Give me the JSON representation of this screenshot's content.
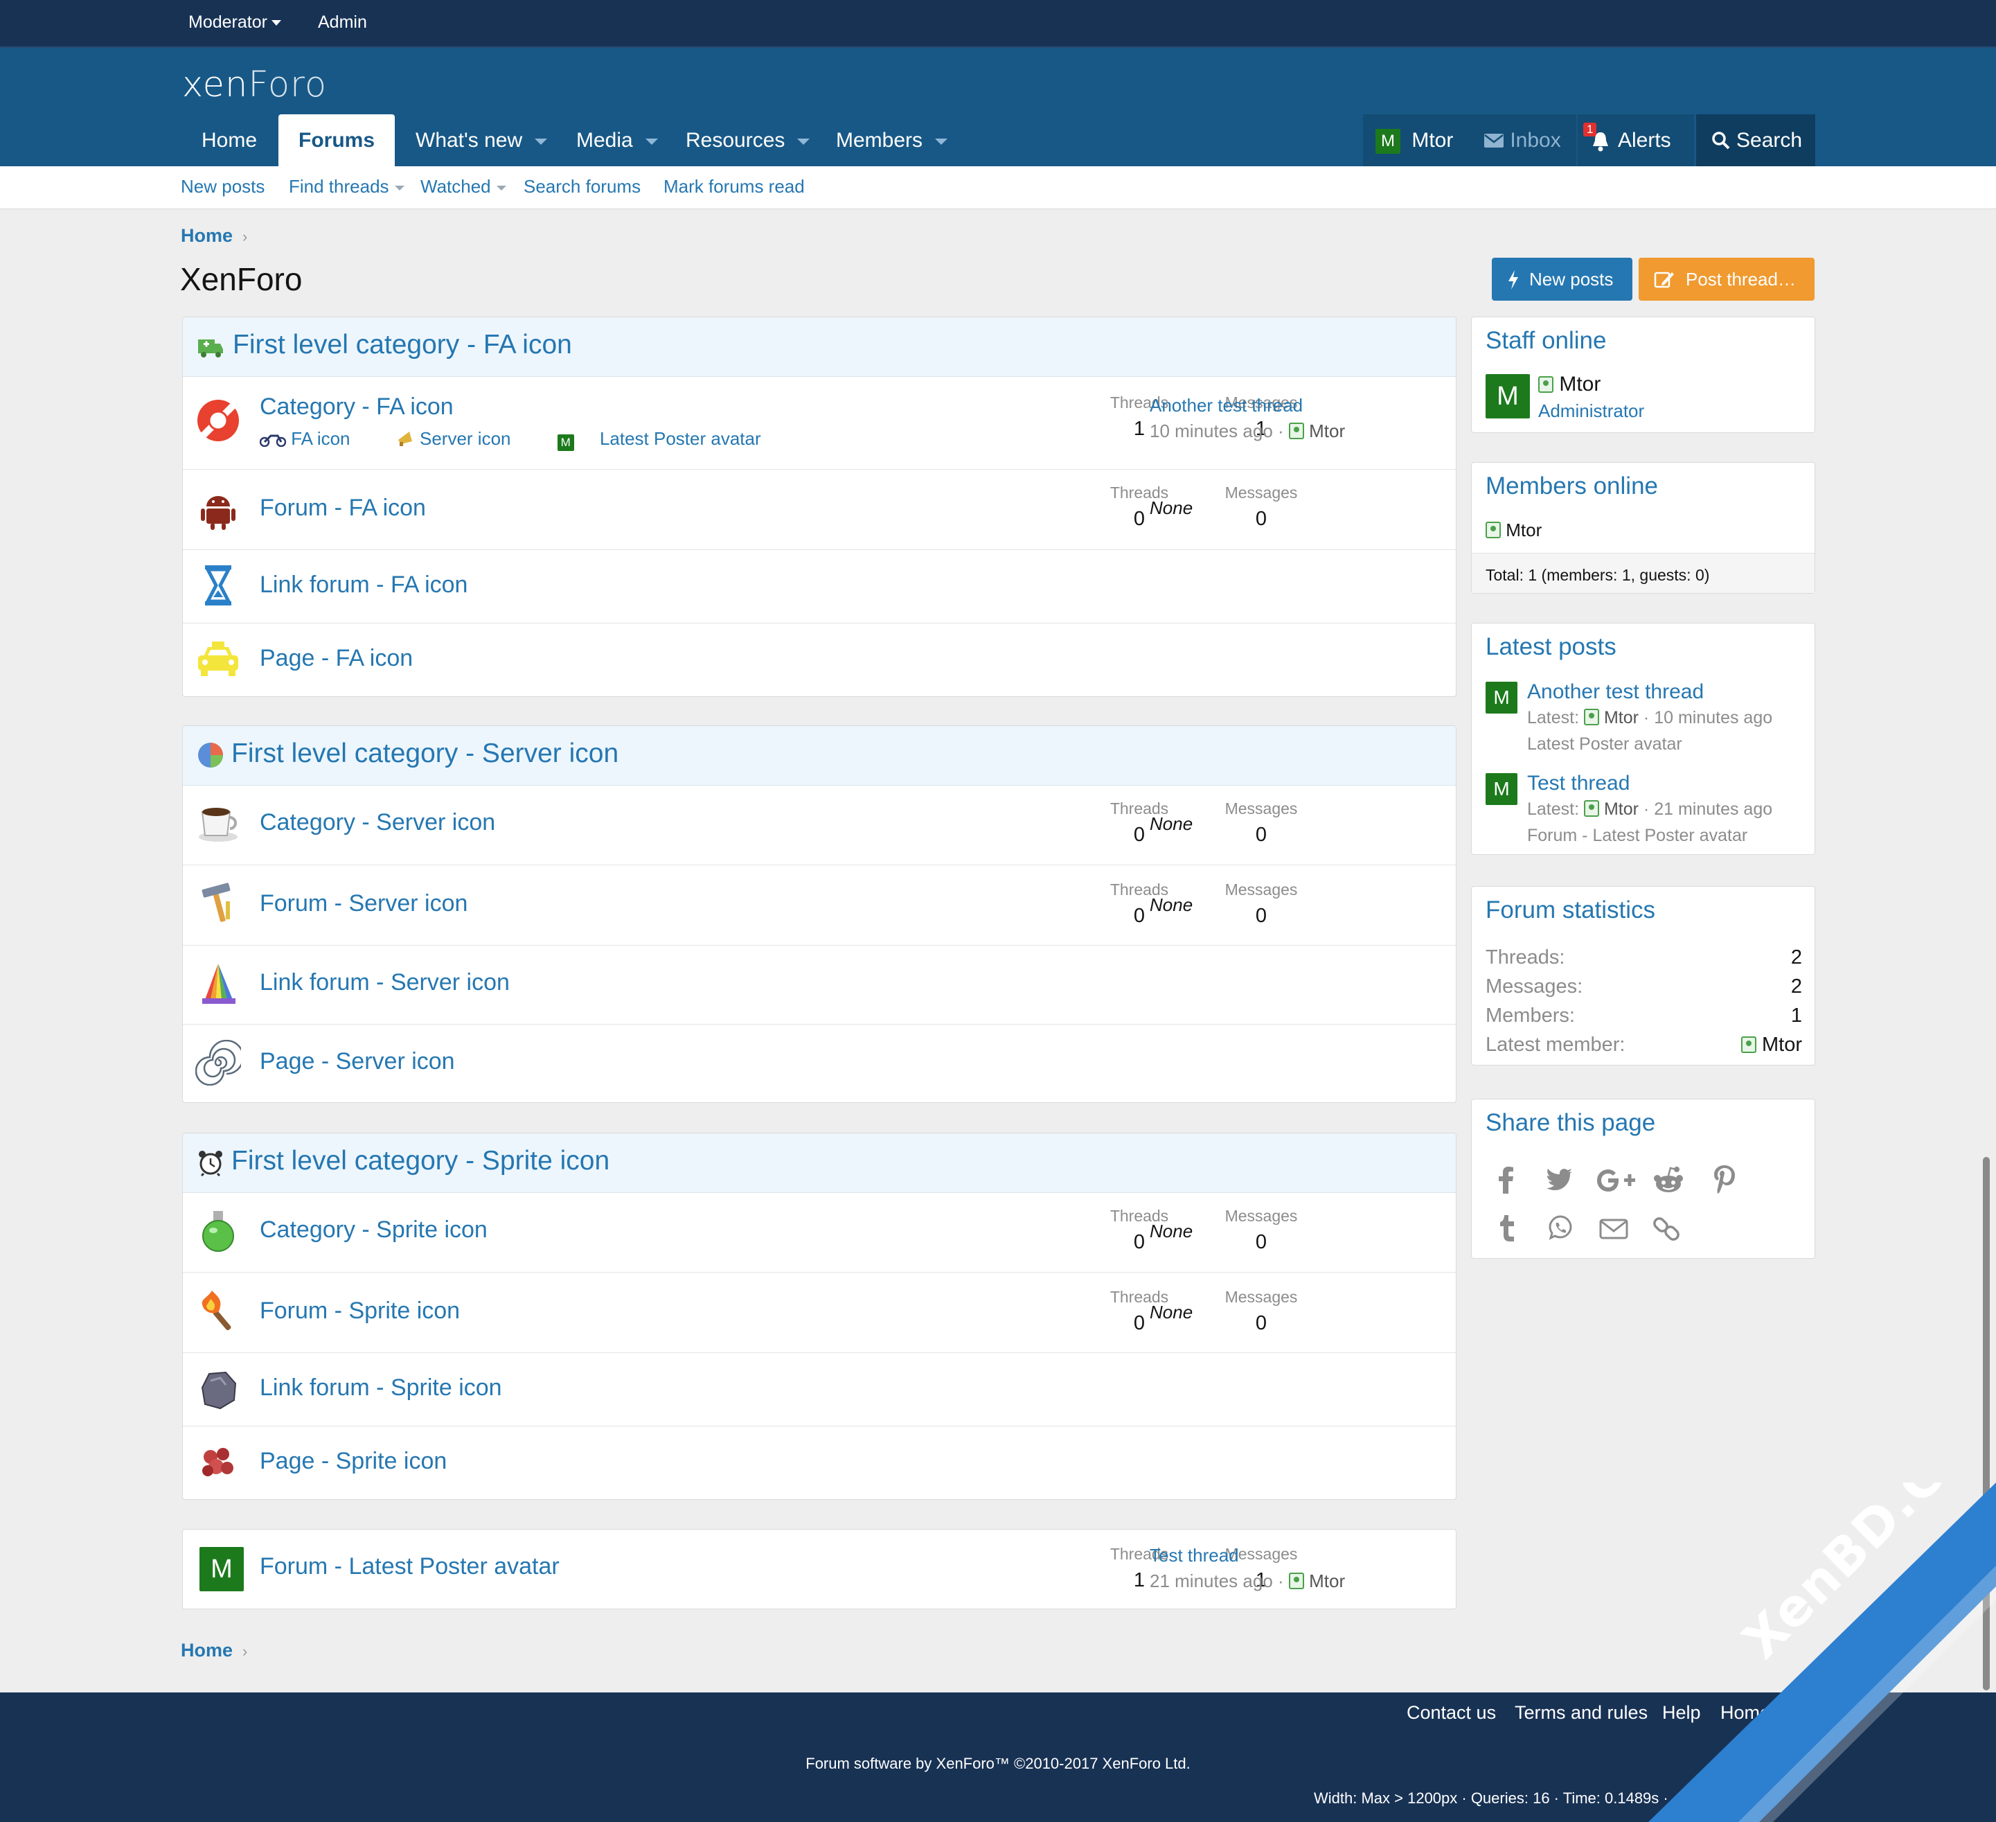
{
  "staffbar": {
    "moderator": "Moderator",
    "admin": "Admin"
  },
  "header": {
    "logo_a": "xen",
    "logo_b": "Foro",
    "nav": [
      {
        "label": "Home"
      },
      {
        "label": "Forums"
      },
      {
        "label": "What's new"
      },
      {
        "label": "Media"
      },
      {
        "label": "Resources"
      },
      {
        "label": "Members"
      }
    ],
    "user": {
      "avatar": "M",
      "name": "Mtor"
    },
    "inbox": "Inbox",
    "alerts": "Alerts",
    "alerts_badge": "1",
    "search": "Search"
  },
  "subnav": {
    "new_posts": "New posts",
    "find_threads": "Find threads",
    "watched": "Watched",
    "search_forums": "Search forums",
    "mark_read": "Mark forums read"
  },
  "breadcrumb": "Home",
  "page_title": "XenForo",
  "actions": {
    "new_posts": "New posts",
    "post_thread": "Post thread…"
  },
  "labels": {
    "threads": "Threads",
    "messages": "Messages",
    "none": "None"
  },
  "categories": [
    {
      "title": "First level category - FA icon",
      "icon": "ambulance-icon",
      "nodes": [
        {
          "title": "Category - FA icon",
          "icon": "life-ring-icon",
          "threads": "1",
          "messages": "1",
          "latest_title": "Another test thread",
          "latest_meta": "10 minutes ago ·",
          "latest_user": "Mtor",
          "subforums": [
            "FA icon",
            "Server icon",
            "Latest Poster avatar"
          ]
        },
        {
          "title": "Forum - FA icon",
          "icon": "android-icon",
          "threads": "0",
          "messages": "0"
        },
        {
          "title": "Link forum - FA icon",
          "icon": "hourglass-icon"
        },
        {
          "title": "Page - FA icon",
          "icon": "taxi-icon"
        }
      ]
    },
    {
      "title": "First level category - Server icon",
      "icon": "pie-chart-icon",
      "nodes": [
        {
          "title": "Category - Server icon",
          "icon": "coffee-cup-icon",
          "threads": "0",
          "messages": "0"
        },
        {
          "title": "Forum - Server icon",
          "icon": "hammer-icon",
          "threads": "0",
          "messages": "0"
        },
        {
          "title": "Link forum - Server icon",
          "icon": "color-swatch-icon"
        },
        {
          "title": "Page - Server icon",
          "icon": "spiral-icon"
        }
      ]
    },
    {
      "title": "First level category - Sprite icon",
      "icon": "alarm-clock-icon",
      "nodes": [
        {
          "title": "Category - Sprite icon",
          "icon": "potion-icon",
          "threads": "0",
          "messages": "0"
        },
        {
          "title": "Forum - Sprite icon",
          "icon": "torch-icon",
          "threads": "0",
          "messages": "0"
        },
        {
          "title": "Link forum - Sprite icon",
          "icon": "rock-icon"
        },
        {
          "title": "Page - Sprite icon",
          "icon": "gem-icon"
        }
      ]
    }
  ],
  "standalone": {
    "title": "Forum - Latest Poster avatar",
    "avatar": "M",
    "threads": "1",
    "messages": "1",
    "latest_title": "Test thread",
    "latest_meta": "21 minutes ago ·",
    "latest_user": "Mtor"
  },
  "sidebar": {
    "staff": {
      "title": "Staff online",
      "avatar": "M",
      "name": "Mtor",
      "role": "Administrator"
    },
    "members": {
      "title": "Members online",
      "name": "Mtor",
      "total": "Total: 1 (members: 1, guests: 0)"
    },
    "latest_posts": {
      "title": "Latest posts",
      "items": [
        {
          "avatar": "M",
          "title": "Another test thread",
          "latest": "Latest:",
          "user": "Mtor",
          "time": "· 10 minutes ago",
          "forum": "Latest Poster avatar"
        },
        {
          "avatar": "M",
          "title": "Test thread",
          "latest": "Latest:",
          "user": "Mtor",
          "time": "· 21 minutes ago",
          "forum": "Forum - Latest Poster avatar"
        }
      ]
    },
    "stats": {
      "title": "Forum statistics",
      "rows": [
        {
          "label": "Threads:",
          "value": "2"
        },
        {
          "label": "Messages:",
          "value": "2"
        },
        {
          "label": "Members:",
          "value": "1"
        },
        {
          "label": "Latest member:",
          "value": "Mtor"
        }
      ]
    },
    "share": {
      "title": "Share this page",
      "icons": [
        "facebook-icon",
        "twitter-icon",
        "google-plus-icon",
        "reddit-icon",
        "pinterest-icon",
        "tumblr-icon",
        "whatsapp-icon",
        "email-icon",
        "link-icon"
      ]
    }
  },
  "footer": {
    "links": [
      "Contact us",
      "Terms and rules",
      "Help",
      "Home"
    ],
    "copyright": "Forum software by XenForo™ ©2010-2017 XenForo Ltd.",
    "debug": "Width: Max > 1200px · Queries: 16 · Time: 0.1489s ·"
  },
  "watermark": "XenBD.Com",
  "colors": {
    "header": "#185886",
    "staffbar": "#183254",
    "link": "#2577b1",
    "new_posts_btn": "#2577b1",
    "post_thread_btn": "#f09a30",
    "avatar": "#1c7a1c"
  }
}
